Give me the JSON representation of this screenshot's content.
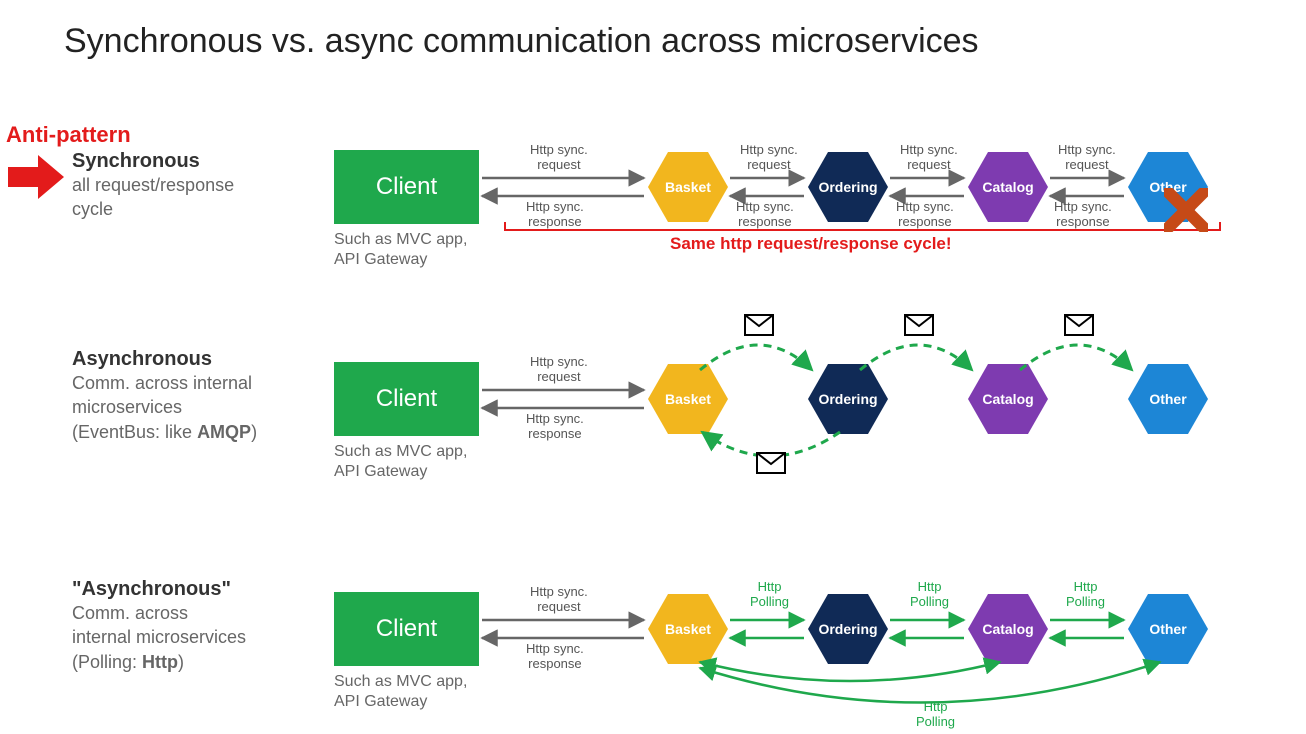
{
  "title": "Synchronous vs. async communication across microservices",
  "antiPattern": "Anti-pattern",
  "sections": {
    "sync": {
      "heading": "Synchronous",
      "desc_l1": "all request/response",
      "desc_l2": "cycle"
    },
    "async": {
      "heading": "Asynchronous",
      "desc_l1": "Comm. across internal",
      "desc_l2": "microservices",
      "desc_l3_pre": "(EventBus: like ",
      "desc_l3_bold": "AMQP",
      "desc_l3_post": ")"
    },
    "poll": {
      "heading": "\"Asynchronous\"",
      "desc_l1": "Comm. across",
      "desc_l2": "internal microservices",
      "desc_l3_pre": "(Polling: ",
      "desc_l3_bold": "Http",
      "desc_l3_post": ")"
    }
  },
  "client": {
    "label": "Client",
    "caption_l1": "Such as MVC app,",
    "caption_l2": "API Gateway"
  },
  "nodes": {
    "basket": "Basket",
    "ordering": "Ordering",
    "catalog": "Catalog",
    "other": "Other"
  },
  "labels": {
    "httpSyncRequest": "Http sync.\nrequest",
    "httpSyncResponse": "Http sync.\nresponse",
    "httpPolling": "Http\nPolling"
  },
  "redBracket": "Same http request/response cycle!"
}
